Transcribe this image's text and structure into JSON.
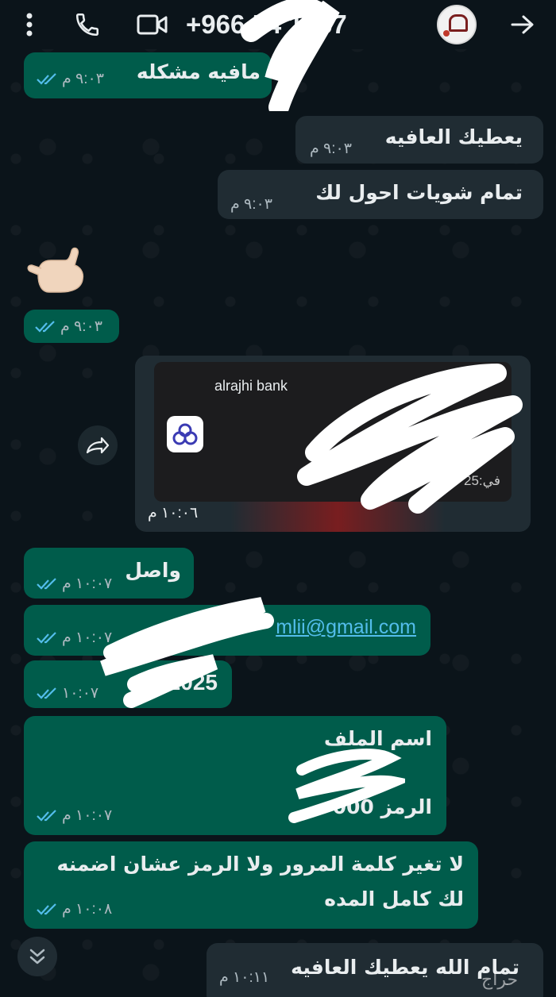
{
  "header": {
    "contact_number": "+966 54 1867"
  },
  "messages": [
    {
      "id": "m1",
      "text": "مافيه مشكله",
      "time": "٩:٠٣ م"
    },
    {
      "id": "m2",
      "text": "يعطيك العافيه",
      "time": "٩:٠٣ م"
    },
    {
      "id": "m3",
      "text": "تمام شويات احول لك",
      "time": "٩:٠٣ م"
    },
    {
      "id": "m4",
      "text": "",
      "time": "٩:٠٣ م"
    },
    {
      "id": "m5",
      "bank_name": "alrajhi bank",
      "partial_text": "في:25",
      "time": "١٠:٠٦ م"
    },
    {
      "id": "m6",
      "text": "واصل",
      "time": "١٠:٠٧ م"
    },
    {
      "id": "m7",
      "text": "mlii@gmail.com",
      "time": "١٠:٠٧ م"
    },
    {
      "id": "m8",
      "text": "2025",
      "time": "١٠:٠٧"
    },
    {
      "id": "m9",
      "line1": "اسم الملف",
      "line2": "الرمز 000",
      "time": "١٠:٠٧ م"
    },
    {
      "id": "m10",
      "line1": "لا تغير كلمة المرور ولا الرمز عشان اضمنه",
      "line2": "لك كامل المده",
      "time": "١٠:٠٨ م"
    },
    {
      "id": "m11",
      "text": "تمام الله يعطيك العافيه",
      "time": "١٠:١١ م"
    }
  ],
  "watermark": "حراج",
  "colors": {
    "background": "#0b141a",
    "outgoing_bubble": "#005c4b",
    "incoming_bubble": "#202c33",
    "read_ticks": "#53bdeb",
    "link": "#53bdeb"
  },
  "icons": [
    "menu-icon",
    "phone-icon",
    "video-icon",
    "back-arrow-icon",
    "double-check-icon",
    "forward-icon",
    "chevron-down-icon",
    "call-me-hand-emoji",
    "alrajhi-logo-icon"
  ]
}
